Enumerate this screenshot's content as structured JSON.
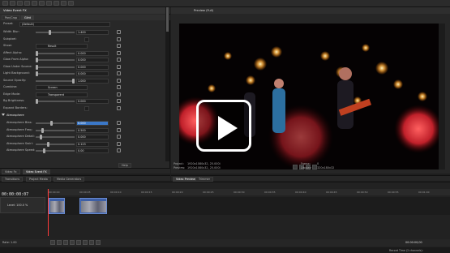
{
  "toolbar": {
    "icons": [
      "open-icon",
      "save-icon",
      "cut-icon",
      "copy-icon",
      "paste-icon",
      "undo-icon",
      "redo-icon",
      "select-tool-icon",
      "edit-tool-icon",
      "split-icon"
    ]
  },
  "fx_panel": {
    "title": "Video Event FX",
    "chain_label": "Pan/Crop",
    "plugin_label": "Glint",
    "preset_label": "Preset:",
    "preset_value": "(Default)",
    "params": [
      {
        "label": "Width Blur:",
        "kind": "slider",
        "value": "1.400",
        "level": 0.35
      },
      {
        "label": "Subpixel:",
        "kind": "checkbox"
      },
      {
        "label": "Show:",
        "kind": "select",
        "value": "Result"
      },
      {
        "label": "Affect Alpha:",
        "kind": "slider",
        "value": "0.000",
        "level": 0.0
      },
      {
        "label": "Glow From Alpha:",
        "kind": "slider",
        "value": "0.000",
        "level": 0.0
      },
      {
        "label": "Glow Under Source:",
        "kind": "slider",
        "value": "0.000",
        "level": 0.0
      },
      {
        "label": "Light Background:",
        "kind": "slider",
        "value": "0.000",
        "level": 0.0
      },
      {
        "label": "Source Opacity:",
        "kind": "slider",
        "value": "1.000",
        "level": 1.0
      },
      {
        "label": "Combine:",
        "kind": "select",
        "value": "Screen"
      },
      {
        "label": "Edge Mode:",
        "kind": "select",
        "value": "Transparent"
      },
      {
        "label": "Bg Brightness:",
        "kind": "slider",
        "value": "0.000",
        "level": 0.0
      },
      {
        "label": "Expand Borders:",
        "kind": "checkbox"
      }
    ],
    "section_title": "Atmosphere",
    "section_params": [
      {
        "label": "Atmosphere Bias:",
        "value": "0.000",
        "level": 0.4,
        "selected": true
      },
      {
        "label": "Atmosphere Freq:",
        "value": "0.500",
        "level": 0.15
      },
      {
        "label": "Atmosphere Detail:",
        "value": "0.000",
        "level": 0.1
      },
      {
        "label": "Atmosphere Swirl:",
        "value": "0.123",
        "level": 0.3
      },
      {
        "label": "Atmosphere Speed:",
        "value": "0.00",
        "level": 0.2
      }
    ],
    "help_label": "Help"
  },
  "left_tabs": [
    "Video Fx",
    "Video Event FX"
  ],
  "left_tabs2": [
    "Transitions",
    "Project Media",
    "Media Generators"
  ],
  "preview": {
    "title": "Preview (Full)",
    "info": {
      "project_label": "Project:",
      "project_value": "1920x1080x32, 25.000i",
      "preview_label": "Preview:",
      "preview_value": "1920x1080x32, 25.000i",
      "frame_label": "Frame:",
      "frame_value": "0",
      "display_label": "Display:",
      "display_value": "320x180x32"
    },
    "tabs": [
      "Video Preview",
      "Trimmer"
    ],
    "play_icon": "play-icon"
  },
  "timeline": {
    "timecode": "00:00:00:07",
    "ruler_ticks": [
      "00:00:00",
      "00:00:05",
      "00:00:10",
      "00:00:15",
      "00:00:20",
      "00:00:25",
      "00:00:30",
      "00:00:35",
      "00:00:40",
      "00:00:45",
      "00:00:50",
      "00:00:55",
      "00:01:00"
    ],
    "track_level": "Level: 100.0 %",
    "rate_label": "Rate: 1.00",
    "end_timecode": "00:00:00;00",
    "status_text": "Record Time (2 channels):"
  },
  "colors": {
    "accent": "#3b78c8",
    "clip": "#3d5fa6",
    "playhead": "#ff3b3b"
  }
}
